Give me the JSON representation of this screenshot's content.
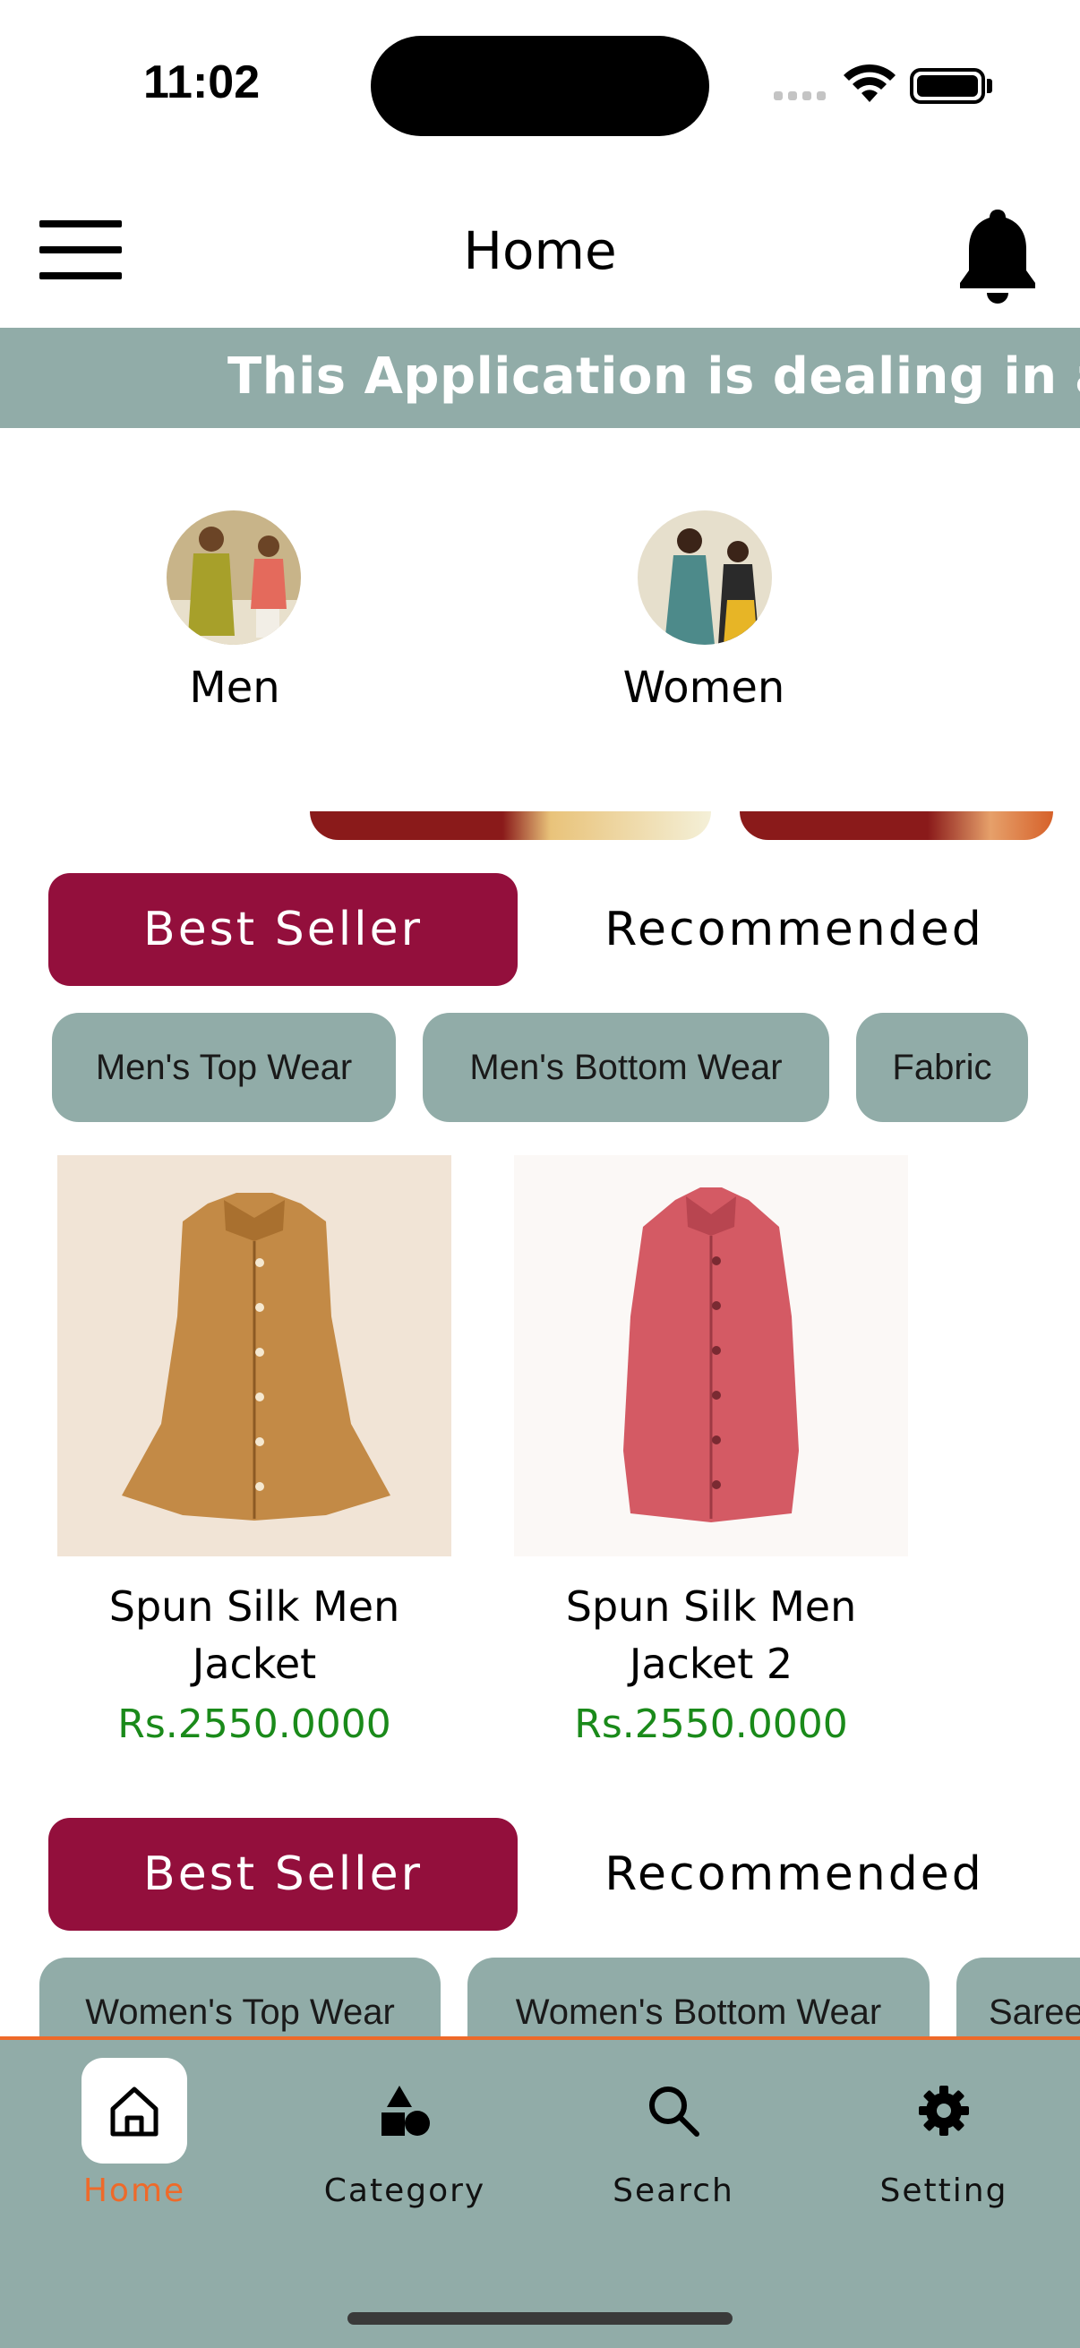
{
  "status_bar": {
    "time": "11:02"
  },
  "header": {
    "title": "Home",
    "menu_icon": "hamburger-menu-icon",
    "notification_icon": "bell-icon"
  },
  "marquee": {
    "text": "This Application is dealing in all"
  },
  "categories": [
    {
      "label": "Men"
    },
    {
      "label": "Women"
    }
  ],
  "section1": {
    "tabs": [
      {
        "label": "Best Seller",
        "active": true
      },
      {
        "label": "Recommended",
        "active": false
      }
    ],
    "chips": [
      "Men's Top Wear",
      "Men's Bottom Wear",
      "Fabric"
    ],
    "products": [
      {
        "name": "Spun Silk Men Jacket",
        "price": "Rs.2550.0000"
      },
      {
        "name": "Spun Silk Men Jacket 2",
        "price": "Rs.2550.0000"
      }
    ]
  },
  "section2": {
    "tabs": [
      {
        "label": "Best Seller",
        "active": true
      },
      {
        "label": "Recommended",
        "active": false
      }
    ],
    "chips": [
      "Women's Top Wear",
      "Women's Bottom Wear",
      "Saree"
    ]
  },
  "bottom_nav": [
    {
      "label": "Home",
      "icon": "home-icon",
      "active": true
    },
    {
      "label": "Category",
      "icon": "shapes-icon",
      "active": false
    },
    {
      "label": "Search",
      "icon": "search-icon",
      "active": false
    },
    {
      "label": "Setting",
      "icon": "gear-icon",
      "active": false
    }
  ],
  "colors": {
    "accent": "#930f3c",
    "chip": "#91aca8",
    "price": "#1a8a1a",
    "nav_active": "#ee6a2a"
  }
}
